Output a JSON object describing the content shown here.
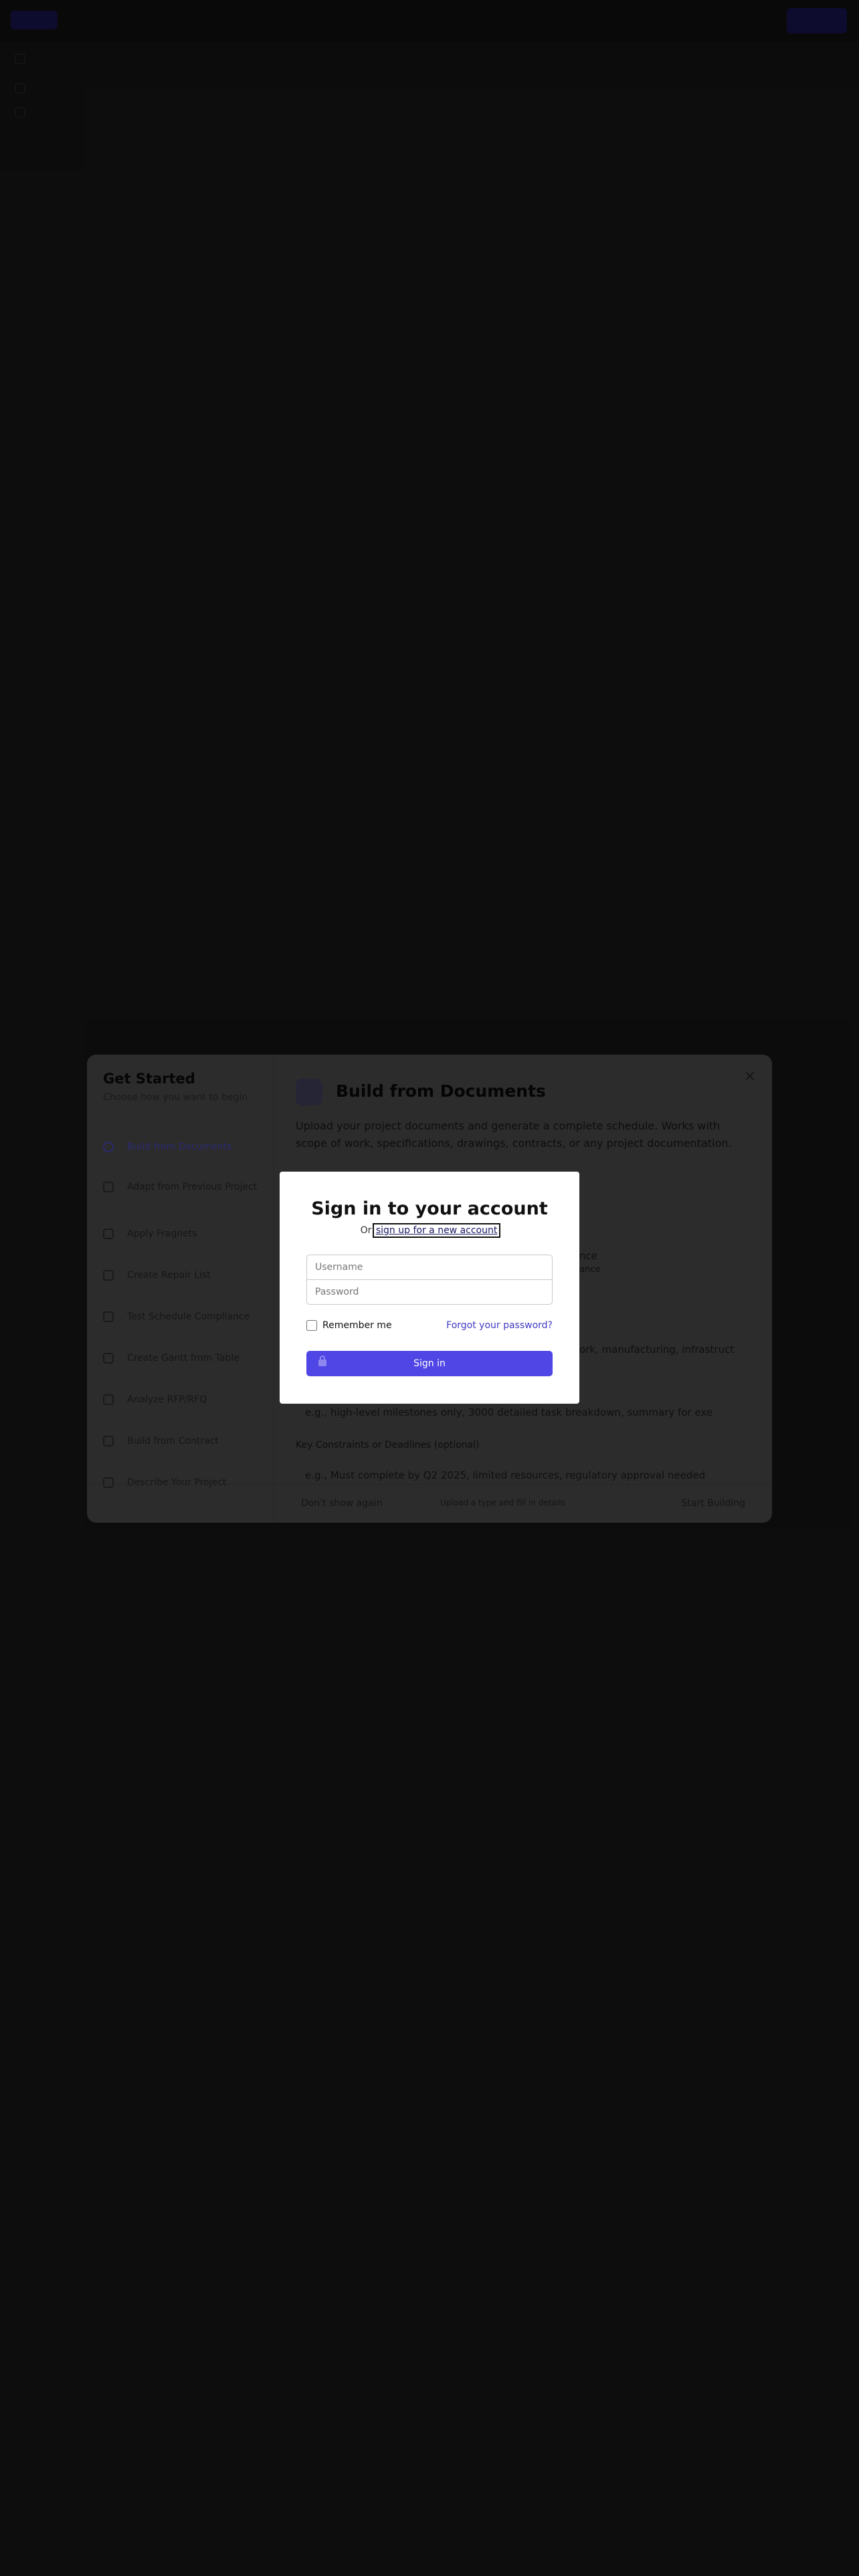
{
  "get_started": {
    "title": "Get Started",
    "subtitle": "Choose how you want to begin",
    "menu": [
      {
        "label": "Build from Documents"
      },
      {
        "label": "Adapt from Previous Project"
      },
      {
        "label": "Apply Fragnets"
      },
      {
        "label": "Create Repair List"
      },
      {
        "label": "Test Schedule Compliance"
      },
      {
        "label": "Create Gantt from Table"
      },
      {
        "label": "Analyze RFP/RFQ"
      },
      {
        "label": "Build from Contract"
      },
      {
        "label": "Describe Your Project"
      }
    ],
    "main_title": "Build from Documents",
    "main_description": "Upload your project documents and generate a complete schedule. Works with scope of work, specifications, drawings, contracts, or any project documentation.",
    "fragment_1": "nce",
    "fragment_2": "ance",
    "fragment_3": "ork, manufacturing, infrastruct",
    "fragment_4": "e.g., high-level milestones only, 3000 detailed task breakdown, summary for exe",
    "constraints_label": "Key Constraints or Deadlines (optional)",
    "fragment_5": "e.g., Must complete by Q2 2025, limited resources, regulatory approval needed",
    "footer_left": "Don't show again",
    "footer_middle": "Upload a type and fill in details",
    "footer_right": "Start Building"
  },
  "signin": {
    "title": "Sign in to your account",
    "or_text": "Or",
    "signup_link": "sign up for a new account",
    "username_placeholder": "Username",
    "password_placeholder": "Password",
    "remember_label": "Remember me",
    "forgot_link": "Forgot your password?",
    "submit_label": "Sign in"
  }
}
